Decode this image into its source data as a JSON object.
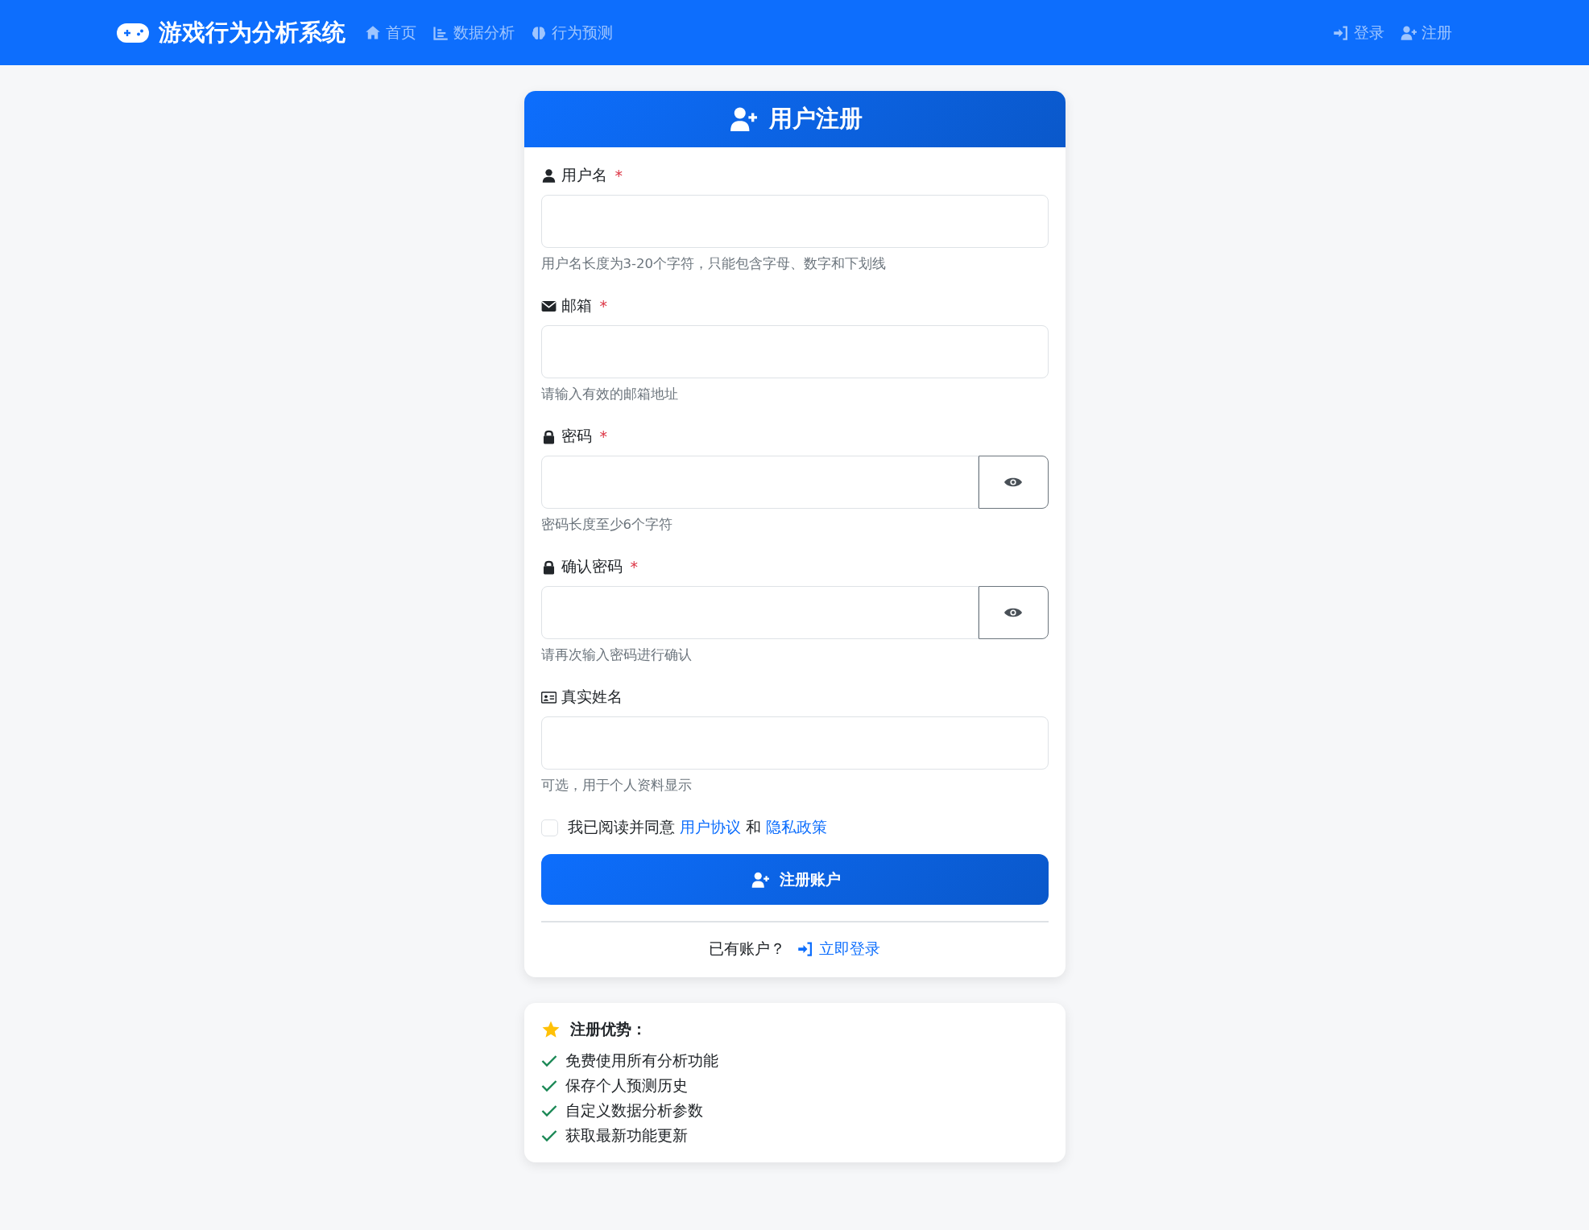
{
  "navbar": {
    "brand": "游戏行为分析系统",
    "links": [
      {
        "label": "首页"
      },
      {
        "label": "数据分析"
      },
      {
        "label": "行为预测"
      }
    ],
    "right_links": [
      {
        "label": "登录"
      },
      {
        "label": "注册"
      }
    ]
  },
  "card": {
    "title": "用户注册",
    "fields": [
      {
        "kind": "text",
        "label": "用户名",
        "required_mark": "*",
        "hint": "用户名长度为3-20个字符，只能包含字母、数字和下划线"
      },
      {
        "kind": "text",
        "label": "邮箱",
        "required_mark": "*",
        "hint": "请输入有效的邮箱地址"
      },
      {
        "kind": "password",
        "label": "密码",
        "required_mark": "*",
        "hint": "密码长度至少6个字符"
      },
      {
        "kind": "password",
        "label": "确认密码",
        "required_mark": "*",
        "hint": "请再次输入密码进行确认"
      },
      {
        "kind": "text",
        "label": "真实姓名",
        "hint": "可选，用于个人资料显示"
      }
    ],
    "terms": {
      "checked": false,
      "prefix": "我已阅读并同意",
      "link_1": "用户协议",
      "conjunction": "和",
      "link_2": "隐私政策"
    },
    "submit": "注册账户",
    "login_prompt": {
      "text": "已有账户？",
      "link": "立即登录"
    }
  },
  "benefits": {
    "title": "注册优势：",
    "items": [
      "免费使用所有分析功能",
      "保存个人预测历史",
      "自定义数据分析参数",
      "获取最新功能更新"
    ]
  }
}
